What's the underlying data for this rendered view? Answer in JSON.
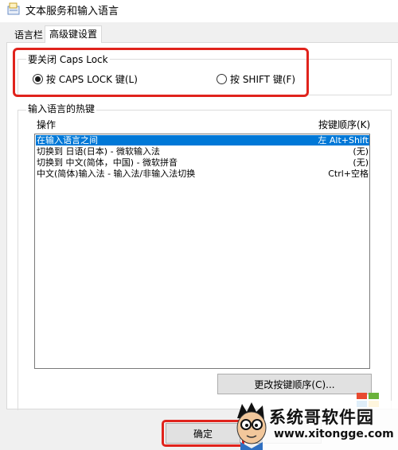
{
  "window": {
    "title": "文本服务和输入语言"
  },
  "tabs": [
    {
      "label": "语言栏",
      "selected": false
    },
    {
      "label": "高级键设置",
      "selected": true
    }
  ],
  "caps_lock_group": {
    "legend": "要关闭 Caps Lock",
    "options": [
      {
        "label": "按 CAPS LOCK 键(L)",
        "checked": true
      },
      {
        "label": "按 SHIFT 键(F)",
        "checked": false
      }
    ]
  },
  "hotkeys": {
    "legend": "输入语言的热键",
    "columns": {
      "action": "操作",
      "key_sequence": "按键顺序(K)"
    },
    "rows": [
      {
        "action": "在输入语言之间",
        "keys": "左 Alt+Shift",
        "selected": true
      },
      {
        "action": "切换到 日语(日本) - 微软输入法",
        "keys": "(无)",
        "selected": false
      },
      {
        "action": "切换到 中文(简体，中国) - 微软拼音",
        "keys": "(无)",
        "selected": false
      },
      {
        "action": "中文(简体)输入法 - 输入法/非输入法切换",
        "keys": "Ctrl+空格",
        "selected": false
      }
    ],
    "change_button": "更改按键顺序(C)..."
  },
  "footer": {
    "ok_button": "确定"
  },
  "watermark": {
    "title": "系统哥软件园",
    "url": "www.xitongge.com"
  },
  "colors": {
    "annotation": "#e0231c",
    "selection": "#0078d7"
  }
}
